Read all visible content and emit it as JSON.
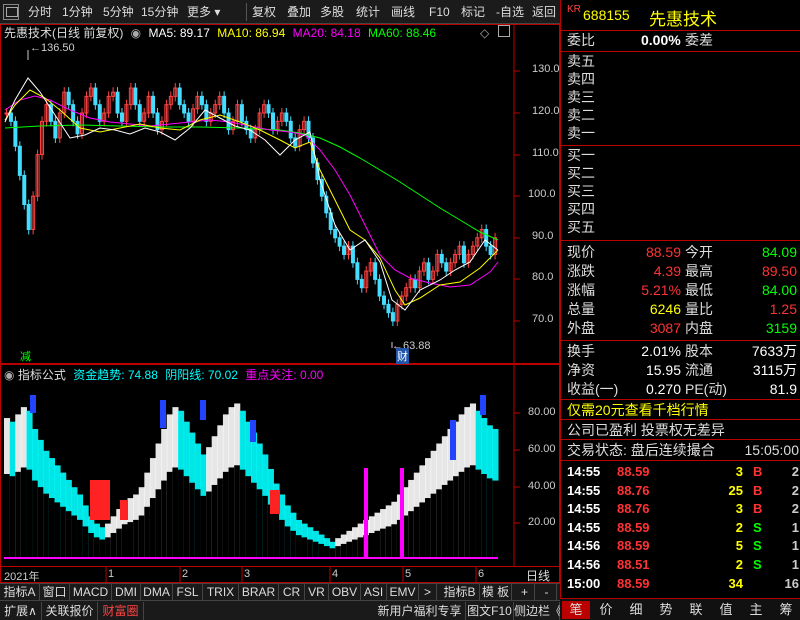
{
  "toolbar": {
    "items": [
      "分时",
      "1分钟",
      "5分钟",
      "15分钟",
      "更多",
      "复权",
      "叠加",
      "多股",
      "统计",
      "画线",
      "F10",
      "标记",
      "-自选",
      "返回"
    ]
  },
  "chart": {
    "stock_title": "先惠技术(日线 前复权)",
    "ma_labels": [
      {
        "text": "MA5: 89.17",
        "color": "#ffffff"
      },
      {
        "text": "MA10: 86.94",
        "color": "#ffff00"
      },
      {
        "text": "MA20: 84.18",
        "color": "#ff00ff"
      },
      {
        "text": "MA60: 88.46",
        "color": "#00ff00"
      }
    ],
    "high_mark": "136.50",
    "low_mark": "63.88",
    "price_axis": [
      "130.0",
      "120.0",
      "110.0",
      "100.0",
      "90.0",
      "80.0",
      "70.0"
    ],
    "marker_jian": "减",
    "marker_cai": "财"
  },
  "indicator": {
    "name": "指标公式",
    "labels": [
      {
        "text": "资金趋势: 74.88",
        "color": "#00ffff"
      },
      {
        "text": "阴阳线: 70.02",
        "color": "#00ffff"
      },
      {
        "text": "重点关注: 0.00",
        "color": "#ff00ff"
      }
    ],
    "axis": [
      "80.00",
      "60.00",
      "40.00",
      "20.00"
    ]
  },
  "time_axis": {
    "year_label": "2021年",
    "months": [
      "1",
      "2",
      "3",
      "4",
      "5",
      "6"
    ],
    "right_label": "日线"
  },
  "tabs_row1": [
    "指标A",
    "窗口",
    "MACD",
    "DMI",
    "DMA",
    "FSL",
    "TRIX",
    "BRAR",
    "CR",
    "VR",
    "OBV",
    "ASI",
    "EMV",
    ">",
    "指标B",
    "模 板",
    "+",
    "-"
  ],
  "tabs_row2": [
    "扩展∧",
    "关联报价",
    "财富圈",
    "新用户福利专享",
    "图文F10",
    "侧边栏《"
  ],
  "quote": {
    "code_prefix": "KR",
    "code": "688155",
    "name": "先惠技术",
    "weibi_label": "委比",
    "weibi_value": "0.00%",
    "weicha_label": "委差",
    "sell_levels": [
      "卖五",
      "卖四",
      "卖三",
      "卖二",
      "卖一"
    ],
    "buy_levels": [
      "买一",
      "买二",
      "买三",
      "买四",
      "买五"
    ],
    "stats": [
      {
        "l1": "现价",
        "v1": "88.59",
        "c1": "#ff3333",
        "l2": "今开",
        "v2": "84.09",
        "c2": "#00ff00"
      },
      {
        "l1": "涨跌",
        "v1": "4.39",
        "c1": "#ff3333",
        "l2": "最高",
        "v2": "89.50",
        "c2": "#ff3333"
      },
      {
        "l1": "涨幅",
        "v1": "5.21%",
        "c1": "#ff3333",
        "l2": "最低",
        "v2": "84.00",
        "c2": "#00ff00"
      },
      {
        "l1": "总量",
        "v1": "6246",
        "c1": "#ffff00",
        "l2": "量比",
        "v2": "1.25",
        "c2": "#ff3333"
      },
      {
        "l1": "外盘",
        "v1": "3087",
        "c1": "#ff3333",
        "l2": "内盘",
        "v2": "3159",
        "c2": "#00ff00"
      }
    ],
    "stats2": [
      {
        "l1": "换手",
        "v1": "2.01%",
        "l2": "股本",
        "v2": "7633万"
      },
      {
        "l1": "净资",
        "v1": "15.95",
        "l2": "流通",
        "v2": "3115万"
      },
      {
        "l1": "收益(一)",
        "v1": "0.270",
        "l2": "PE(动)",
        "v2": "81.9"
      }
    ],
    "promo": "仅需20元查看千档行情",
    "notice": "公司已盈利 投票权无差异",
    "status_label": "交易状态:",
    "status_value": "盘后连续撮合",
    "status_time": "15:05:00",
    "ticks": [
      {
        "time": "14:55",
        "price": "88.59",
        "vol": "3",
        "bs": "B",
        "flag": "2"
      },
      {
        "time": "14:55",
        "price": "88.76",
        "vol": "25",
        "bs": "B",
        "flag": "2"
      },
      {
        "time": "14:55",
        "price": "88.76",
        "vol": "3",
        "bs": "B",
        "flag": "2"
      },
      {
        "time": "14:55",
        "price": "88.59",
        "vol": "2",
        "bs": "S",
        "flag": "1"
      },
      {
        "time": "14:56",
        "price": "88.59",
        "vol": "5",
        "bs": "S",
        "flag": "1"
      },
      {
        "time": "14:56",
        "price": "88.51",
        "vol": "2",
        "bs": "S",
        "flag": "1"
      },
      {
        "time": "15:00",
        "price": "88.59",
        "vol": "34",
        "bs": "",
        "flag": "16"
      }
    ]
  },
  "bottom_nav": [
    "笔",
    "价",
    "细",
    "势",
    "联",
    "值",
    "主",
    "筹"
  ]
}
